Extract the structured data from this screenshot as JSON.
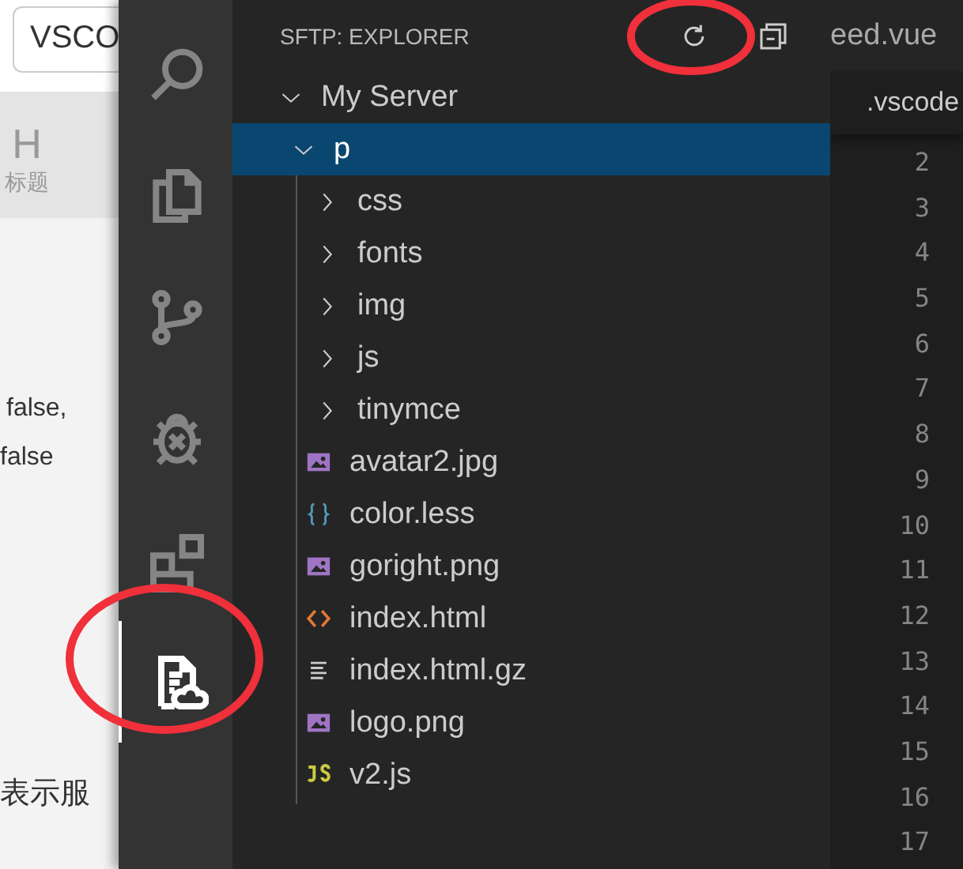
{
  "background_page": {
    "search_value": "VSCO",
    "toolbar": [
      {
        "icon_text": "H",
        "label": "标题"
      }
    ],
    "lines": [
      "false,",
      "false",
      "表示服"
    ]
  },
  "activity_bar": {
    "items": [
      {
        "kind": "search",
        "selected": false
      },
      {
        "kind": "files",
        "selected": false
      },
      {
        "kind": "git",
        "selected": false
      },
      {
        "kind": "debug",
        "selected": false
      },
      {
        "kind": "extensions",
        "selected": false
      },
      {
        "kind": "sftp",
        "selected": true
      }
    ]
  },
  "sidebar": {
    "title": "SFTP: EXPLORER",
    "tree": [
      {
        "name": "My Server",
        "kind": "folder",
        "expanded": true,
        "selected": false,
        "children": [
          {
            "name": "p",
            "kind": "folder",
            "expanded": true,
            "selected": true,
            "children": [
              {
                "name": "css",
                "kind": "folder",
                "expanded": false,
                "selected": false
              },
              {
                "name": "fonts",
                "kind": "folder",
                "expanded": false,
                "selected": false
              },
              {
                "name": "img",
                "kind": "folder",
                "expanded": false,
                "selected": false
              },
              {
                "name": "js",
                "kind": "folder",
                "expanded": false,
                "selected": false
              },
              {
                "name": "tinymce",
                "kind": "folder",
                "expanded": false,
                "selected": false
              },
              {
                "name": "avatar2.jpg",
                "kind": "image",
                "selected": false
              },
              {
                "name": "color.less",
                "kind": "less",
                "selected": false
              },
              {
                "name": "goright.png",
                "kind": "image",
                "selected": false
              },
              {
                "name": "index.html",
                "kind": "html",
                "selected": false
              },
              {
                "name": "index.html.gz",
                "kind": "text",
                "selected": false
              },
              {
                "name": "logo.png",
                "kind": "image",
                "selected": false
              },
              {
                "name": "v2.js",
                "kind": "js",
                "selected": false
              }
            ]
          }
        ]
      }
    ]
  },
  "editor": {
    "tab": "eed.vue",
    "breadcrumb": ".vscode",
    "line_numbers": [
      "2",
      "3",
      "4",
      "5",
      "6",
      "7",
      "8",
      "9",
      "10",
      "11",
      "12",
      "13",
      "14",
      "15",
      "16",
      "17"
    ]
  }
}
